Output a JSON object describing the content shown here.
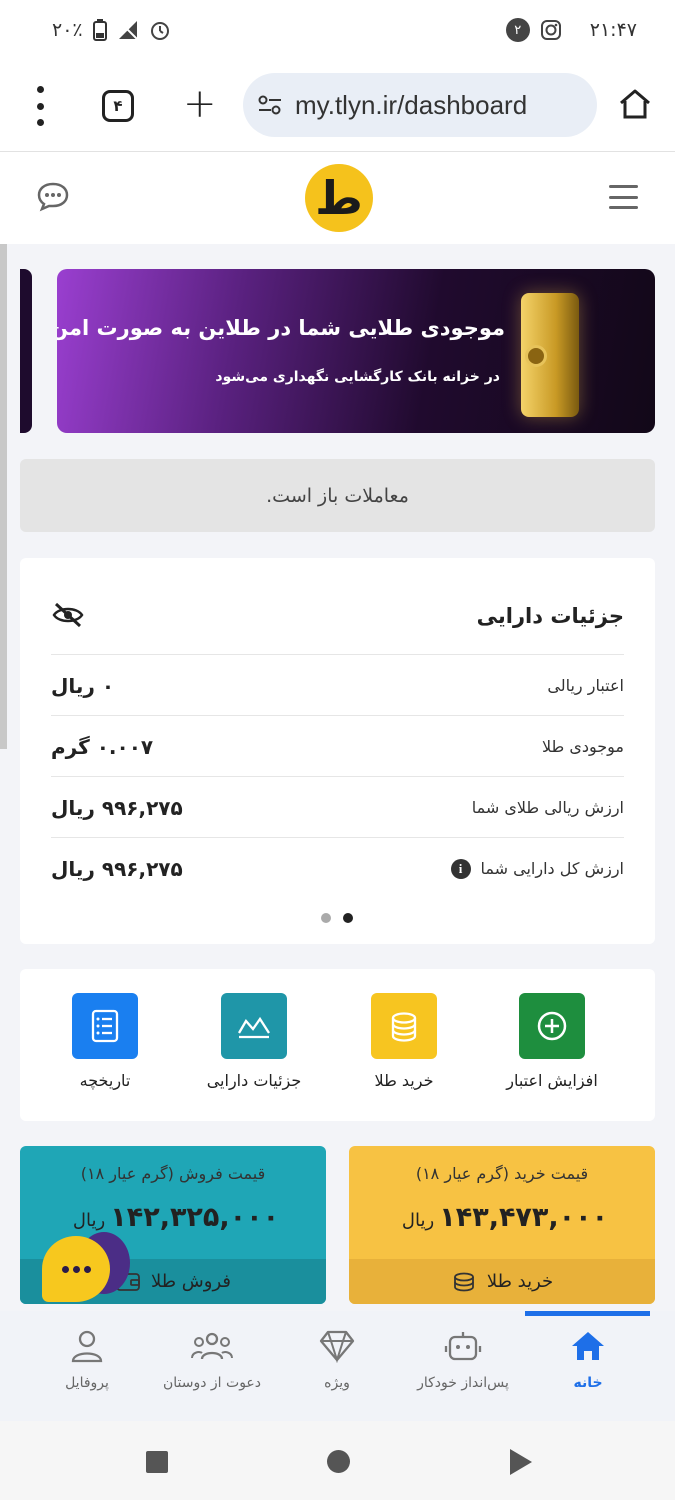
{
  "status_bar": {
    "time": "۲۱:۴۷",
    "notif_badge": "۲",
    "battery": "۲۰٪",
    "network": "4G"
  },
  "browser": {
    "url": "my.tlyn.ir/dashboard",
    "tab_count": "۴"
  },
  "header": {
    "logo_text": "ط"
  },
  "banner": {
    "title": "موجودی طلایی شما در طلاین به صورت امن",
    "subtitle": "در خزانه بانک کارگشایی نگهداری می‌شود"
  },
  "market_status": "معاملات باز است.",
  "assets": {
    "title": "جزئیات دارایی",
    "rows": [
      {
        "label": "اعتبار ریالی",
        "value": "۰ ریال"
      },
      {
        "label": "موجودی طلا",
        "value": "۰.۰۰۷ گرم"
      },
      {
        "label": "ارزش ریالی طلای شما",
        "value": "۹۹۶,۲۷۵ ریال"
      },
      {
        "label": "ارزش کل دارایی شما",
        "value": "۹۹۶,۲۷۵ ریال"
      }
    ],
    "info_glyph": "i"
  },
  "actions": [
    {
      "label": "افزایش اعتبار",
      "color": "#1e8e3e"
    },
    {
      "label": "خرید طلا",
      "color": "#f7c520"
    },
    {
      "label": "جزئیات دارایی",
      "color": "#1f96a8"
    },
    {
      "label": "تاریخچه",
      "color": "#1a7ff0"
    }
  ],
  "prices": {
    "buy": {
      "title": "قیمت خرید (گرم عیار ۱۸)",
      "value": "۱۴۳,۴۷۳,۰۰۰",
      "currency": "ریال",
      "button": "خرید طلا",
      "color": "#f7c243",
      "button_color": "#e8b13a"
    },
    "sell": {
      "title": "قیمت فروش (گرم عیار ۱۸)",
      "value": "۱۴۲,۳۲۵,۰۰۰",
      "currency": "ریال",
      "button": "فروش طلا",
      "color": "#1fa6b6",
      "button_color": "#1a8f9d"
    }
  },
  "bottom_nav": [
    {
      "label": "خانه",
      "active": true
    },
    {
      "label": "پس‌انداز خودکار",
      "active": false
    },
    {
      "label": "ویژه",
      "active": false
    },
    {
      "label": "دعوت از دوستان",
      "active": false
    },
    {
      "label": "پروفایل",
      "active": false
    }
  ]
}
